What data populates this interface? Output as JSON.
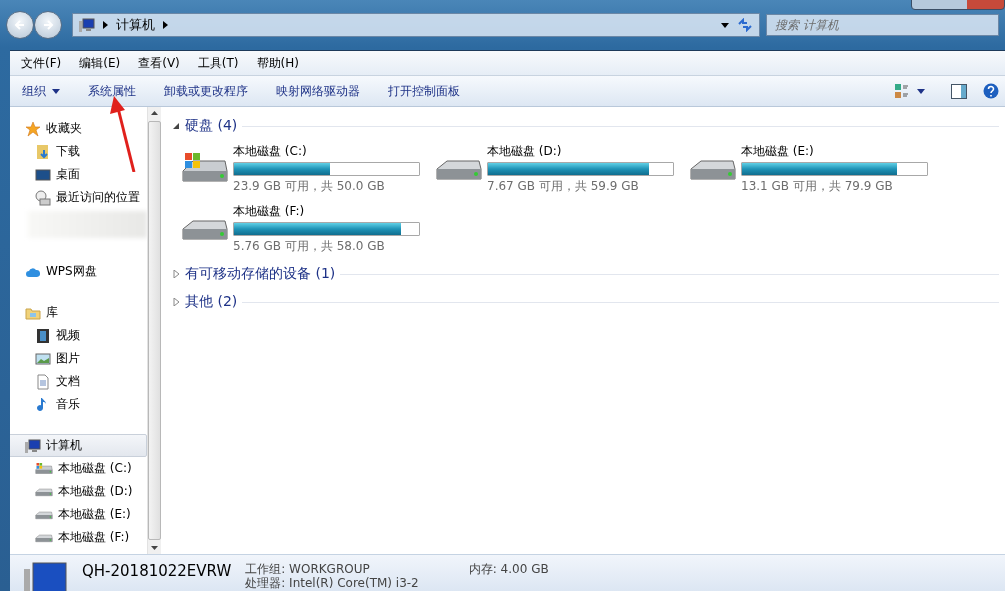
{
  "address_bar": {
    "path": [
      "计算机"
    ]
  },
  "search": {
    "placeholder": "搜索 计算机"
  },
  "menu": [
    "文件(F)",
    "编辑(E)",
    "查看(V)",
    "工具(T)",
    "帮助(H)"
  ],
  "toolbar": [
    {
      "label": "组织",
      "dropdown": true
    },
    {
      "label": "系统属性",
      "dropdown": false
    },
    {
      "label": "卸载或更改程序",
      "dropdown": false
    },
    {
      "label": "映射网络驱动器",
      "dropdown": false
    },
    {
      "label": "打开控制面板",
      "dropdown": false
    }
  ],
  "sidebar": [
    {
      "label": "收藏夹",
      "kind": "star",
      "selected": false,
      "children": [
        {
          "label": "下载",
          "kind": "download",
          "selected": false
        },
        {
          "label": "桌面",
          "kind": "desktop",
          "selected": false
        },
        {
          "label": "最近访问的位置",
          "kind": "recent",
          "selected": false
        },
        {
          "kind": "blurred"
        }
      ]
    },
    {
      "label": "WPS网盘",
      "kind": "cloud",
      "selected": false
    },
    {
      "label": "库",
      "kind": "library",
      "selected": false,
      "children": [
        {
          "label": "视频",
          "kind": "video",
          "selected": false
        },
        {
          "label": "图片",
          "kind": "picture",
          "selected": false
        },
        {
          "label": "文档",
          "kind": "document",
          "selected": false
        },
        {
          "label": "音乐",
          "kind": "music",
          "selected": false
        }
      ]
    },
    {
      "label": "计算机",
      "kind": "computer",
      "selected": true,
      "children": [
        {
          "label": "本地磁盘 (C:)",
          "kind": "system",
          "selected": false
        },
        {
          "label": "本地磁盘 (D:)",
          "kind": "drive",
          "selected": false
        },
        {
          "label": "本地磁盘 (E:)",
          "kind": "drive",
          "selected": false
        },
        {
          "label": "本地磁盘 (F:)",
          "kind": "drive",
          "selected": false
        }
      ]
    }
  ],
  "sections": [
    {
      "title": "硬盘 (4)",
      "expanded": true,
      "drives": [
        {
          "name": "本地磁盘 (C:)",
          "kind": "system",
          "level": 0.52,
          "space": "23.9 GB 可用，共 50.0 GB"
        },
        {
          "name": "本地磁盘 (D:)",
          "kind": "drive",
          "level": 0.87,
          "space": "7.67 GB 可用，共 59.9 GB"
        },
        {
          "name": "本地磁盘 (E:)",
          "kind": "drive",
          "level": 0.84,
          "space": "13.1 GB 可用，共 79.9 GB"
        },
        {
          "name": "本地磁盘 (F:)",
          "kind": "drive",
          "level": 0.9,
          "space": "5.76 GB 可用，共 58.0 GB"
        }
      ]
    },
    {
      "title": "有可移动存储的设备 (1)",
      "expanded": false
    },
    {
      "title": "其他 (2)",
      "expanded": false
    }
  ],
  "details": {
    "computer_name": "QH-20181022EVRW",
    "fields": [
      "工作组: WORKGROUP",
      "内存: 4.00 GB",
      "处理器: Intel(R) Core(TM) i3-2"
    ]
  }
}
